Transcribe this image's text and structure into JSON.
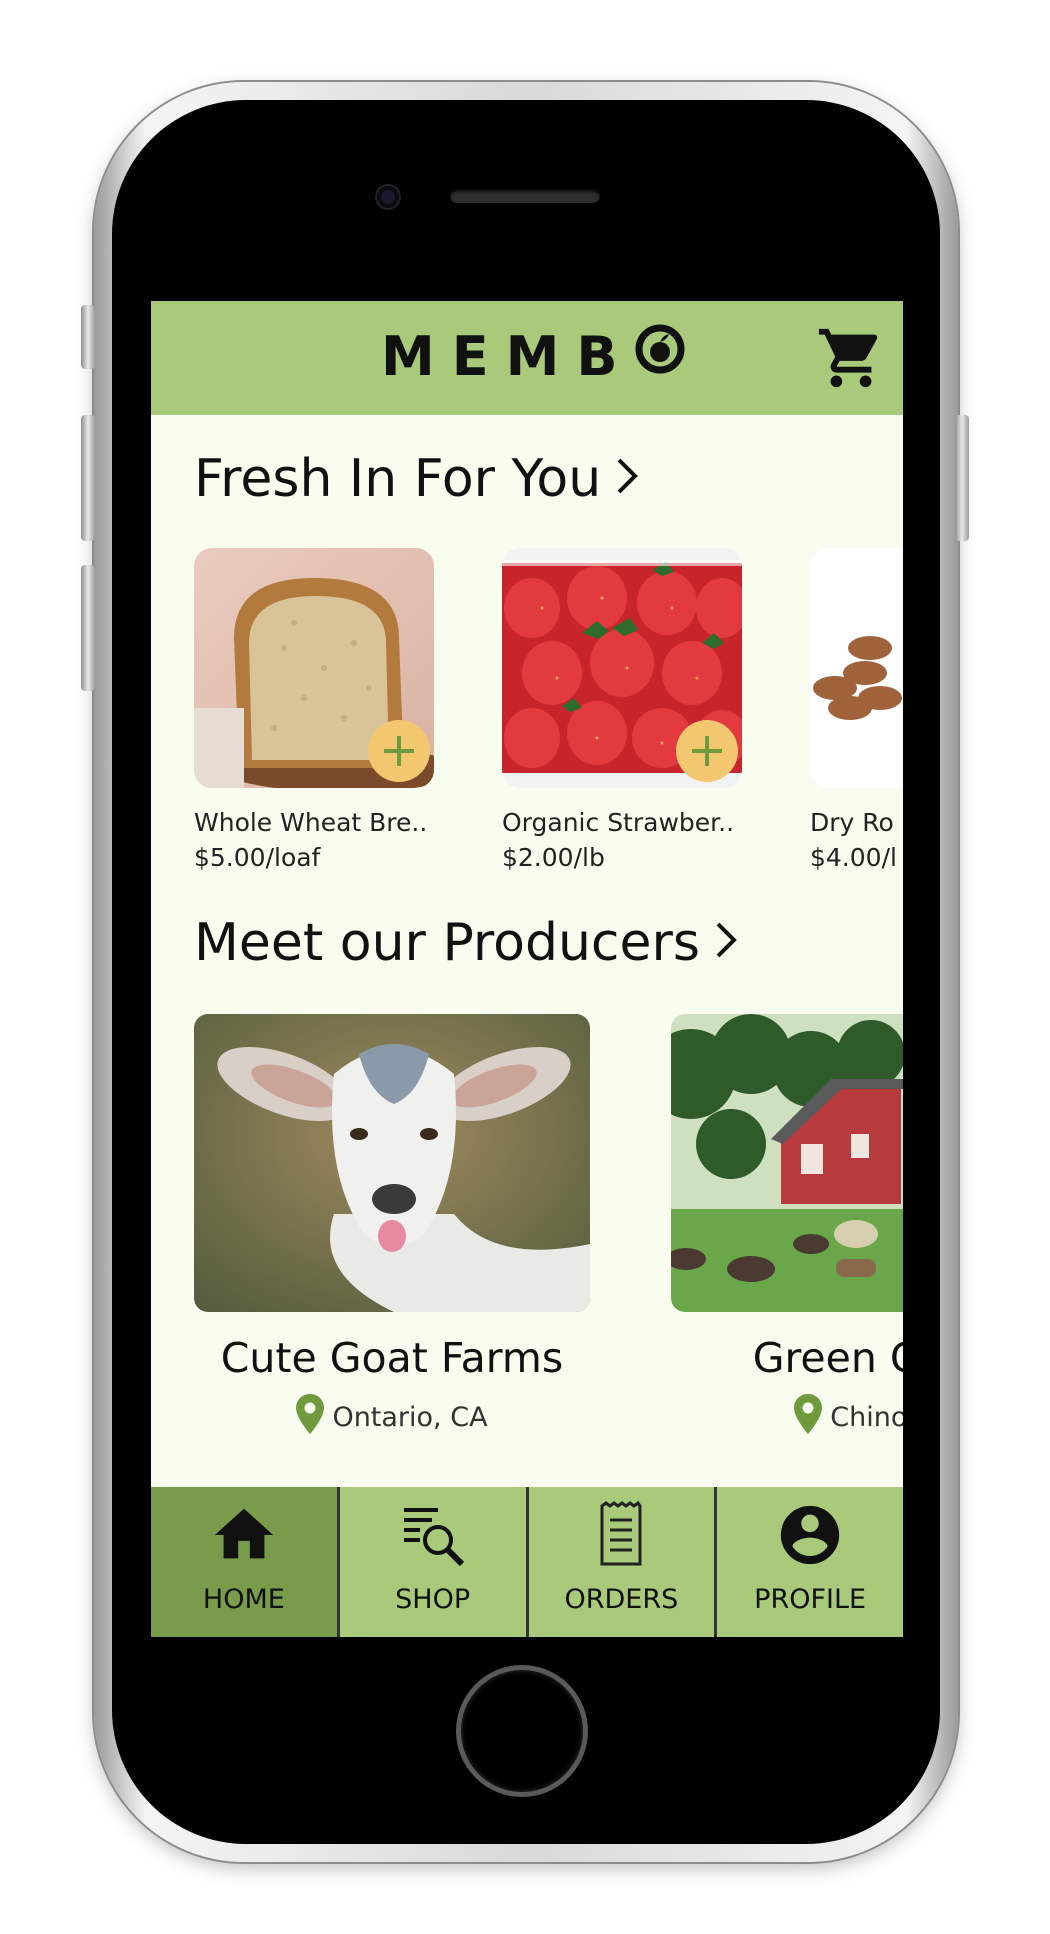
{
  "app": {
    "logo_text": "MEMB",
    "cart_icon": "cart-icon"
  },
  "fresh_section": {
    "title": "Fresh In For You",
    "items": [
      {
        "name": "Whole Wheat Bre..",
        "price": "$5.00/loaf",
        "image": "bread-image"
      },
      {
        "name": "Organic Strawber..",
        "price": "$2.00/lb",
        "image": "strawberries-image"
      },
      {
        "name": "Dry Ro",
        "price": "$4.00/l",
        "image": "almonds-image"
      }
    ]
  },
  "producers_section": {
    "title": "Meet our Producers",
    "items": [
      {
        "name": "Cute Goat Farms",
        "location": "Ontario, CA",
        "image": "goat-image"
      },
      {
        "name": "Green Garc",
        "location": "Chino Hi",
        "image": "farm-image"
      }
    ]
  },
  "tabbar": {
    "tabs": [
      {
        "label": "HOME",
        "icon": "home-icon",
        "active": true
      },
      {
        "label": "SHOP",
        "icon": "shop-search-icon",
        "active": false
      },
      {
        "label": "ORDERS",
        "icon": "receipt-icon",
        "active": false
      },
      {
        "label": "PROFILE",
        "icon": "profile-icon",
        "active": false
      }
    ]
  },
  "colors": {
    "header_green": "#a8ca7a",
    "active_tab_green": "#789c4c",
    "background": "#f9fdef",
    "add_button": "#f2c76f",
    "pin_green": "#6f9a3e"
  }
}
